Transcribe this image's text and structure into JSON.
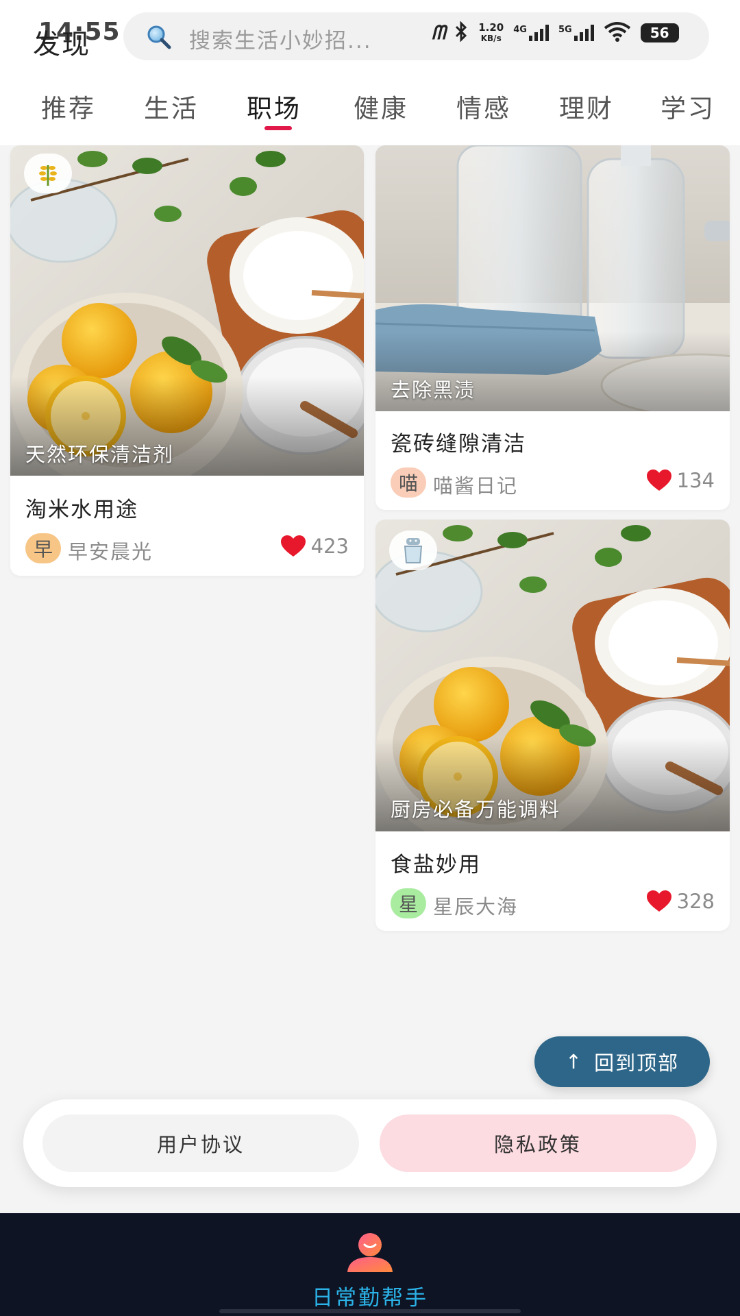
{
  "status": {
    "time": "14:55",
    "network_speed": "1.20",
    "network_speed_unit": "KB/s",
    "net1": "4G",
    "net2": "5G",
    "battery": "56"
  },
  "header": {
    "title": "发现",
    "search_placeholder": "搜索生活小妙招..."
  },
  "tabs": [
    {
      "label": "推荐"
    },
    {
      "label": "生活"
    },
    {
      "label": "职场"
    },
    {
      "label": "健康"
    },
    {
      "label": "情感"
    },
    {
      "label": "理财"
    },
    {
      "label": "学习"
    }
  ],
  "active_tab": "职场",
  "cards": [
    {
      "image_caption": "天然环保清洁剂",
      "title": "淘米水用途",
      "avatar_char": "早",
      "author": "早安晨光",
      "likes": "423"
    },
    {
      "image_caption": "去除黑渍",
      "title": "瓷砖缝隙清洁",
      "avatar_char": "喵",
      "author": "喵酱日记",
      "likes": "134"
    },
    {
      "image_caption": "厨房必备万能调料",
      "title": "食盐妙用",
      "avatar_char": "星",
      "author": "星辰大海",
      "likes": "328"
    }
  ],
  "back_to_top": {
    "arrow": "↑",
    "label": "回到顶部"
  },
  "agreements": {
    "user_agreement": "用户协议",
    "privacy_policy": "隐私政策"
  },
  "app": {
    "name": "日常勤帮手"
  },
  "colors": {
    "accent_red": "#e0194a",
    "back_to_top": "#2d6688",
    "bottom_bar": "#0e1424",
    "app_name": "#2bb3e8",
    "heart": "#e8182c"
  }
}
